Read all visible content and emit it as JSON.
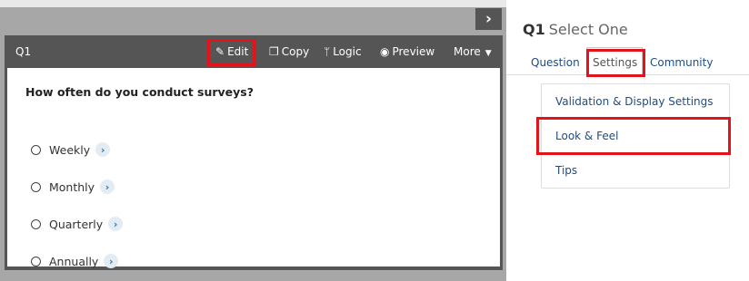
{
  "question": {
    "number": "Q1",
    "text": "How often do you conduct surveys?",
    "choices": [
      "Weekly",
      "Monthly",
      "Quarterly",
      "Annually"
    ]
  },
  "toolbar": {
    "edit": "Edit",
    "copy": "Copy",
    "logic": "Logic",
    "preview": "Preview",
    "more": "More"
  },
  "panel": {
    "title_num": "Q1",
    "title_type": "Select One",
    "tabs": [
      "Question",
      "Settings",
      "Community"
    ],
    "active_tab": "Settings",
    "items": [
      "Validation & Display Settings",
      "Look & Feel",
      "Tips"
    ]
  },
  "colors": {
    "highlight": "#e3131b",
    "link": "#1f4c82",
    "header_bg": "#555555"
  },
  "icons": {
    "collapse": "chevron-right-icon",
    "edit": "pencil-icon",
    "copy": "copy-icon",
    "logic": "branch-icon",
    "preview": "eye-icon",
    "more": "caret-down-icon",
    "choice_action": "chevron-circle-right-icon"
  }
}
